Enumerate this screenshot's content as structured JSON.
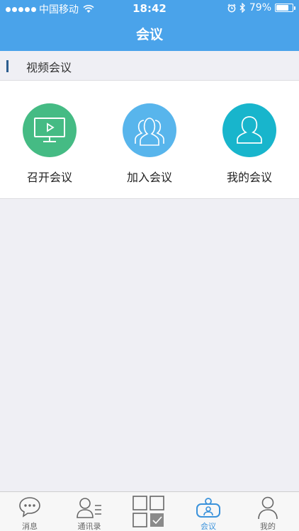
{
  "status_bar": {
    "carrier": "中国移动",
    "time": "18:42",
    "battery_text": "79%",
    "battery_level": 0.79,
    "signal_bars_filled": 5
  },
  "nav": {
    "title": "会议"
  },
  "section": {
    "title": "视频会议"
  },
  "meeting_options": [
    {
      "label": "召开会议",
      "icon": "monitor-play-icon",
      "color": "#45bb84"
    },
    {
      "label": "加入会议",
      "icon": "group-people-icon",
      "color": "#58b5ec"
    },
    {
      "label": "我的会议",
      "icon": "person-icon",
      "color": "#18b5cc"
    }
  ],
  "tabbar": {
    "items": [
      {
        "label": "消息",
        "icon": "chat-bubble-icon",
        "active": false
      },
      {
        "label": "通讯录",
        "icon": "contacts-icon",
        "active": false
      },
      {
        "label": "",
        "icon": "apps-grid-icon",
        "active": false
      },
      {
        "label": "会议",
        "icon": "meeting-icon",
        "active": true
      },
      {
        "label": "我的",
        "icon": "profile-icon",
        "active": false
      }
    ]
  },
  "colors": {
    "nav_bg": "#4aa3ea",
    "tab_active": "#3a92db"
  }
}
